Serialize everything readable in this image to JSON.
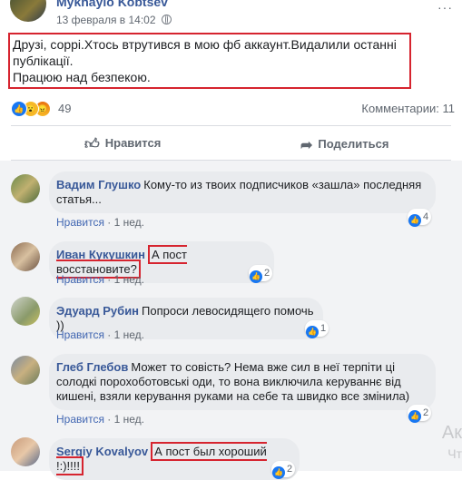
{
  "post": {
    "author": "Mykhaylo Kobtsev",
    "date": "13 февраля в 14:02",
    "more": "···",
    "text_lines": [
      "Друзі, соррі.Хтось втрутився в мою фб аккаунт.Видалили останні",
      "публікації.",
      "Працюю над безпекою."
    ],
    "reactions_count": "49",
    "comments_label": "Комментарии: 11",
    "like_label": "Нравится",
    "share_label": "Поделиться"
  },
  "comments": [
    {
      "name": "Вадим Глушко",
      "text": "Кому-то из твоих подписчиков «зашла» последняя статья...",
      "like": "Нравится",
      "time": "· 1 нед.",
      "reactions": "4"
    },
    {
      "name": "Иван Кукушкин",
      "text": "А пост восстановите?",
      "like": "Нравится",
      "time": "· 1 нед.",
      "reactions": "2"
    },
    {
      "name": "Эдуард Рубин",
      "text": "Попроси левосидящего помочь ))",
      "like": "Нравится",
      "time": "· 1 нед.",
      "reactions": "1"
    },
    {
      "name": "Глеб Глебов",
      "text": "Может то совість? Нема вже сил в неї терпіти ці солодкі порохоботовські оди, то вона виключила керуваннє від кишені, взяли керування руками на себе та швидко все змінила)",
      "like": "Нравится",
      "time": "· 1 нед.",
      "reactions": "2"
    },
    {
      "name": "Sergiy Kovalyov",
      "text": "А пост был хороший !:)!!!!",
      "like": "",
      "time": "",
      "reactions": "2"
    }
  ],
  "watermark": {
    "line1": "Ак",
    "line2": "Чт"
  },
  "colors": {
    "highlight": "#d6242f",
    "link": "#385898",
    "like": "#1877f2"
  }
}
